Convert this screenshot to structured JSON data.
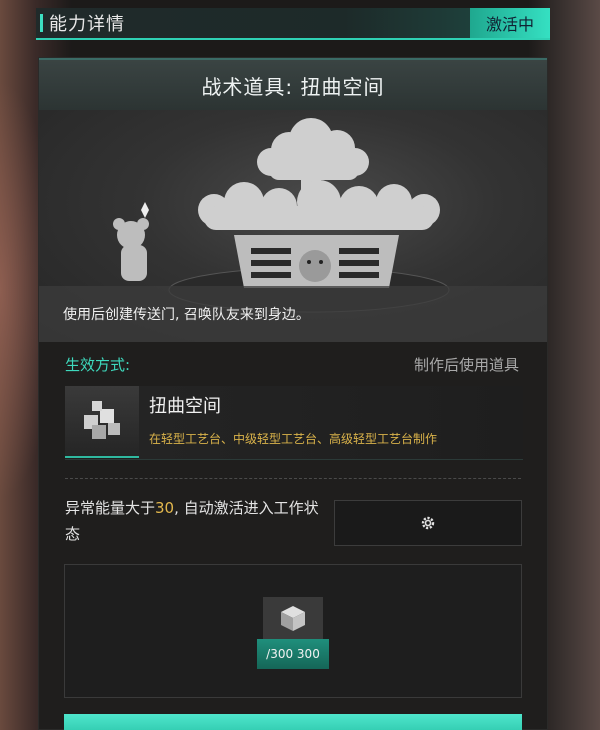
{
  "header": {
    "title": "能力详情",
    "status": "激活中"
  },
  "card": {
    "title": "战术道具: 扭曲空间",
    "description": "使用后创建传送门, 召唤队友来到身边。",
    "effect": {
      "label": "生效方式:",
      "value": "制作后使用道具"
    },
    "item": {
      "name": "扭曲空间",
      "source": "在轻型工艺台、中级轻型工艺台、高级轻型工艺台制作"
    },
    "activation": {
      "text_before": "异常能量大于",
      "number": "30",
      "text_after": ", 自动激活进入工作状态"
    },
    "slot": {
      "count": "/300  300"
    }
  },
  "colors": {
    "accent": "#2fd1b4",
    "gold": "#e3b84d",
    "card_bg": "#1f1e1d"
  }
}
